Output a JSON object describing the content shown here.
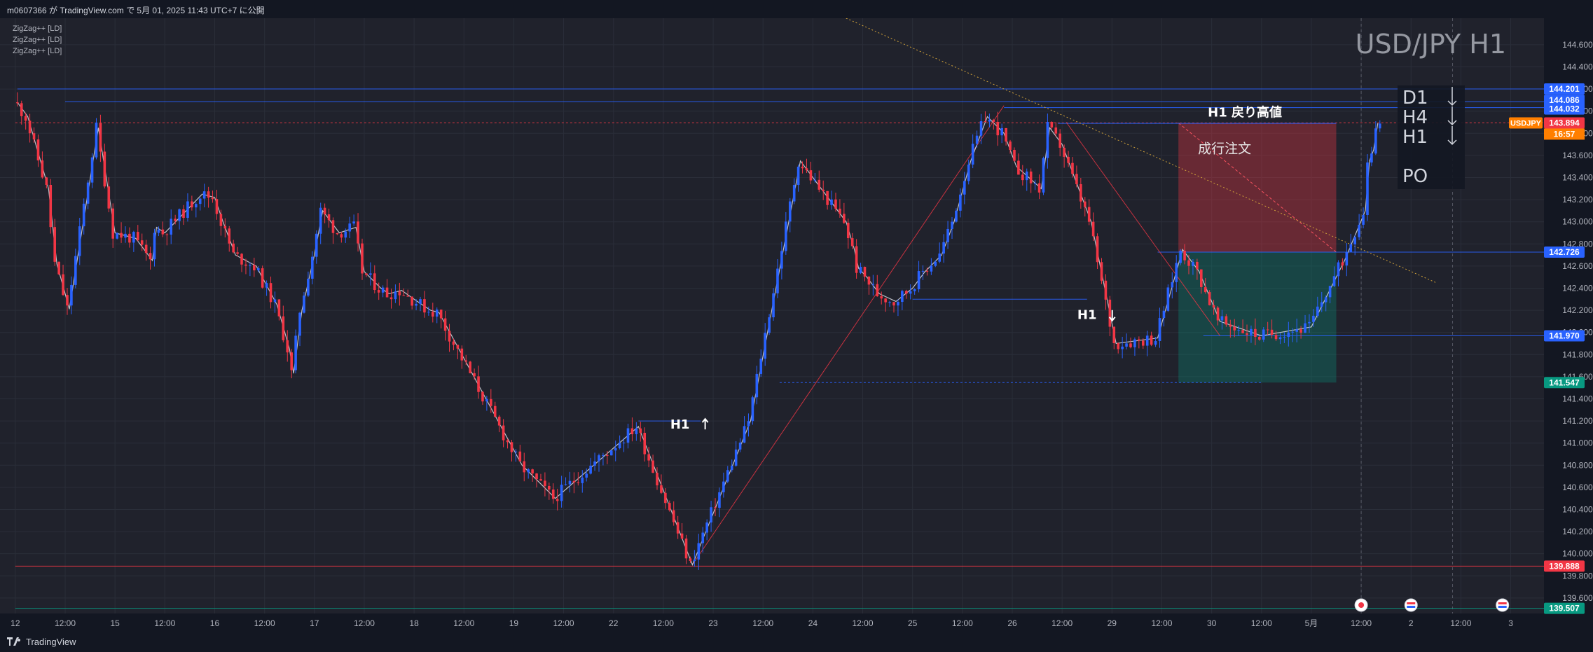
{
  "header": {
    "published": "m0607366 が TradingView.com で 5月 01, 2025 11:43 UTC+7 に公開"
  },
  "footer": {
    "brand": "TradingView"
  },
  "chart_data": {
    "type": "line",
    "title": "USD/JPY H1",
    "xlabel": "",
    "ylabel": "",
    "legend_position": "top-left",
    "legend": [
      "ZigZag++ [LD]",
      "ZigZag++ [LD]",
      "ZigZag++ [LD]"
    ],
    "ylim": [
      139.46,
      144.84
    ],
    "y_ticks": [
      "144.600",
      "144.400",
      "144.200",
      "144.000",
      "143.800",
      "143.600",
      "143.400",
      "143.200",
      "143.000",
      "142.800",
      "142.600",
      "142.400",
      "142.200",
      "142.000",
      "141.800",
      "141.600",
      "141.400",
      "141.200",
      "141.000",
      "140.800",
      "140.600",
      "140.400",
      "140.200",
      "140.000",
      "139.800",
      "139.600"
    ],
    "x_ticks": [
      "12",
      "12:00",
      "15",
      "12:00",
      "16",
      "12:00",
      "17",
      "12:00",
      "18",
      "12:00",
      "19",
      "12:00",
      "22",
      "12:00",
      "23",
      "12:00",
      "24",
      "12:00",
      "25",
      "12:00",
      "26",
      "12:00",
      "29",
      "12:00",
      "30",
      "12:00",
      "5月",
      "12:00",
      "2",
      "12:00",
      "3"
    ],
    "x_tick_times": [
      0,
      12,
      24,
      36,
      48,
      60,
      72,
      84,
      96,
      108,
      120,
      132,
      144,
      156,
      168,
      180,
      192,
      204,
      216,
      228,
      240,
      252,
      264,
      276,
      288,
      300,
      312,
      324,
      336,
      348,
      360
    ],
    "grid": true,
    "note": "time axis in trading hours from 12th 00:00 (weekends skipped)",
    "series": [
      {
        "name": "ZigZag++ [LD]",
        "color": "#d1d4dc",
        "x": [
          0.5,
          3,
          8,
          10,
          12,
          13,
          20,
          24,
          29,
          33,
          34,
          36,
          45,
          48,
          50,
          53,
          58,
          63,
          66,
          67,
          69,
          72,
          74,
          78,
          82,
          84,
          88,
          90,
          93,
          96,
          98,
          100,
          102,
          122,
          130,
          150,
          163,
          177,
          189,
          200,
          202,
          203,
          205,
          208,
          212,
          216,
          219,
          223,
          226,
          230,
          234,
          238,
          241,
          247,
          249,
          252,
          259,
          265,
          275,
          281,
          285,
          290,
          300,
          312,
          320,
          325,
          326,
          327,
          328
        ],
        "y": [
          144.08,
          143.95,
          143.3,
          142.62,
          142.35,
          142.21,
          143.85,
          142.9,
          142.85,
          142.65,
          142.95,
          142.9,
          143.25,
          143.22,
          143.0,
          142.7,
          142.6,
          142.25,
          141.85,
          141.63,
          142.2,
          142.7,
          143.1,
          142.9,
          142.95,
          142.55,
          142.4,
          142.35,
          142.38,
          142.3,
          142.25,
          142.2,
          142.18,
          140.8,
          140.5,
          141.15,
          139.9,
          141.2,
          143.55,
          143.0,
          142.75,
          142.58,
          142.5,
          142.35,
          142.28,
          142.4,
          142.55,
          142.7,
          143.0,
          143.55,
          143.95,
          143.8,
          143.5,
          143.3,
          143.85,
          143.7,
          143.0,
          141.9,
          141.95,
          142.75,
          142.55,
          142.1,
          141.97,
          142.05,
          142.65,
          143.1,
          143.55,
          143.65,
          143.89
        ]
      }
    ],
    "legend_colors": {
      "up": "#2962ff",
      "down": "#f23645"
    },
    "levels": [
      {
        "label": "144.201",
        "value": 144.201,
        "color": "#2962ff"
      },
      {
        "label": "144.086",
        "value": 144.086,
        "color": "#2962ff"
      },
      {
        "label": "144.032",
        "value": 144.032,
        "color": "#2962ff"
      },
      {
        "label": "143.894",
        "value": 143.894,
        "color": "#f23645"
      },
      {
        "label": "142.726",
        "value": 142.726,
        "color": "#2962ff"
      },
      {
        "label": "141.970",
        "value": 141.97,
        "color": "#2962ff"
      },
      {
        "label": "141.547",
        "value": 141.547,
        "color": "#089981"
      },
      {
        "label": "139.888",
        "value": 139.888,
        "color": "#f23645"
      },
      {
        "label": "139.507",
        "value": 139.507,
        "color": "#089981"
      }
    ],
    "price_tag": {
      "symbol": "USDJPY",
      "countdown": "16:57",
      "color": "#ff7f00"
    },
    "trade_box": {
      "label": "成行注文",
      "entry": 142.726,
      "target": 143.894,
      "stop": 141.547,
      "x_start": 280,
      "x_end": 318,
      "profit_color": "#f23645",
      "loss_color": "#089981"
    },
    "annotations": [
      {
        "text": "H1 戻り高値",
        "x": 296,
        "y": 143.95
      },
      {
        "text": "H1",
        "x": 160,
        "y": 141.13,
        "arrow": "up"
      },
      {
        "text": "H1",
        "x": 258,
        "y": 142.12,
        "arrow": "down"
      }
    ],
    "trend_panel": [
      {
        "tf": "D1",
        "dir": "down"
      },
      {
        "tf": "H4",
        "dir": "down"
      },
      {
        "tf": "H1",
        "dir": "down"
      },
      {
        "tf": "PO",
        "dir": ""
      }
    ],
    "event_markers": [
      {
        "x": 324,
        "kind": "dot"
      },
      {
        "x": 336,
        "kind": "flag"
      },
      {
        "x": 358,
        "kind": "flag"
      }
    ]
  }
}
